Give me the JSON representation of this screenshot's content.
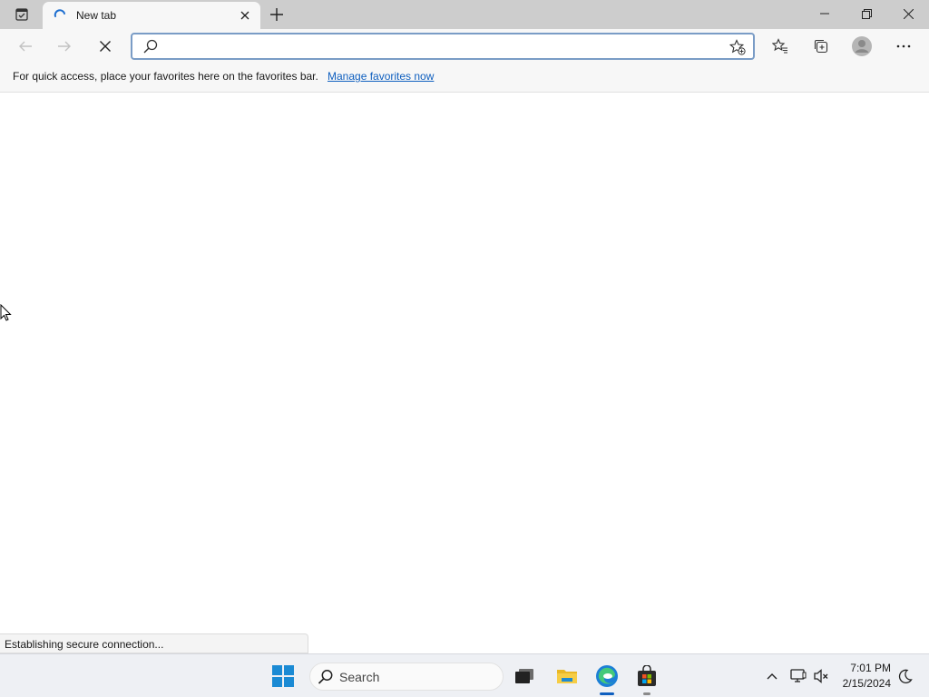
{
  "browser": {
    "tab": {
      "title": "New tab"
    },
    "omnibox": {
      "value": "",
      "placeholder": ""
    },
    "favorites_bar": {
      "message": "For quick access, place your favorites here on the favorites bar.",
      "link": "Manage favorites now"
    },
    "status": "Establishing secure connection..."
  },
  "taskbar": {
    "search_label": "Search",
    "clock": {
      "time": "7:01 PM",
      "date": "2/15/2024"
    }
  },
  "icons": {
    "tab_actions": "tab-actions-icon",
    "new_tab": "plus-icon",
    "back": "back-arrow-icon",
    "forward": "forward-arrow-icon",
    "stop": "stop-icon",
    "favorites": "favorites-icon",
    "collections": "collections-icon",
    "profile": "profile-icon",
    "menu": "more-icon"
  },
  "colors": {
    "accent": "#0f5fbf",
    "tab_strip": "#cdcdcd",
    "toolbar": "#f7f7f7"
  }
}
